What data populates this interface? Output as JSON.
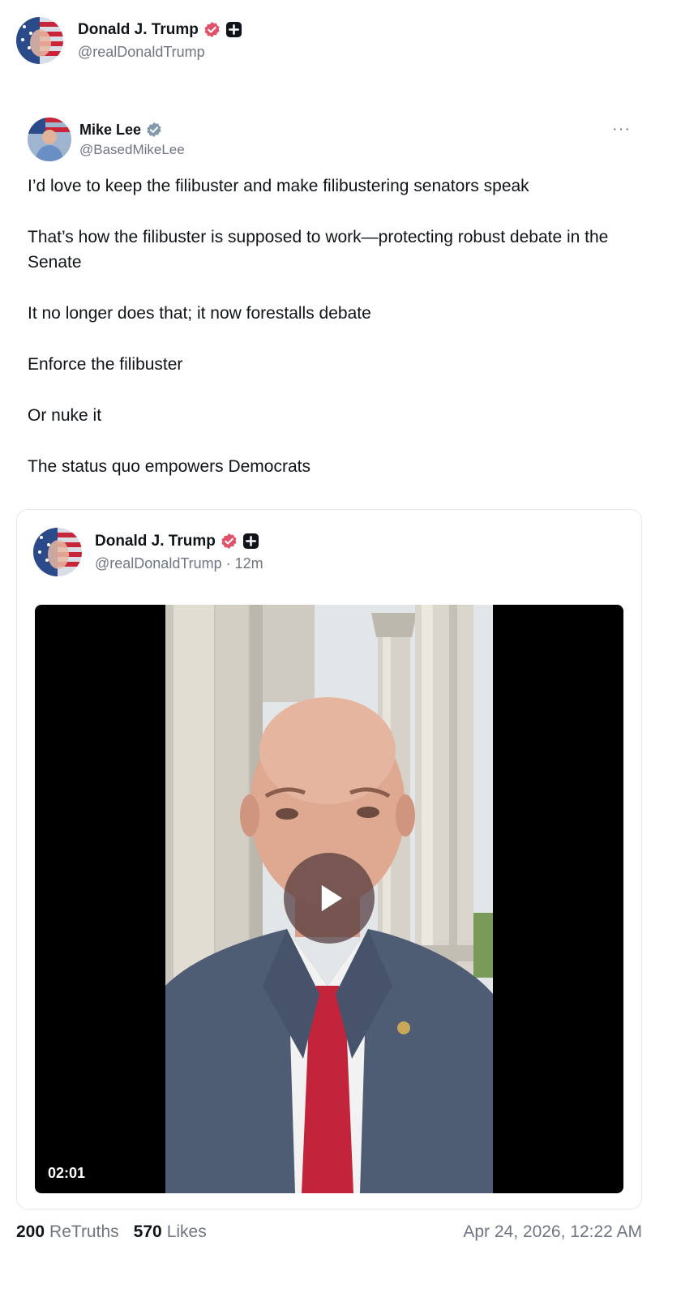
{
  "outer_post": {
    "author_name": "Donald J. Trump",
    "author_handle": "@realDonaldTrump",
    "verified_badge_color": "#e0516a"
  },
  "embedded_tweet": {
    "author_name": "Mike Lee",
    "author_handle": "@BasedMikeLee",
    "verified_badge_color": "#829aab",
    "more_label": "···",
    "paragraphs": [
      "I’d love to keep the filibuster and make filibustering senators speak",
      "That’s how the filibuster is supposed to work—protecting robust debate in the Senate",
      "It no longer does that; it now forestalls debate",
      "Enforce the filibuster",
      "Or nuke it",
      "The status quo empowers Democrats"
    ]
  },
  "quoted_post": {
    "author_name": "Donald J. Trump",
    "author_handle": "@realDonaldTrump · 12m",
    "video": {
      "duration": "02:01",
      "play_icon": "play-icon"
    }
  },
  "footer": {
    "retruths_count": "200",
    "retruths_label": "ReTruths",
    "likes_count": "570",
    "likes_label": "Likes",
    "timestamp": "Apr 24, 2026, 12:22 AM"
  }
}
